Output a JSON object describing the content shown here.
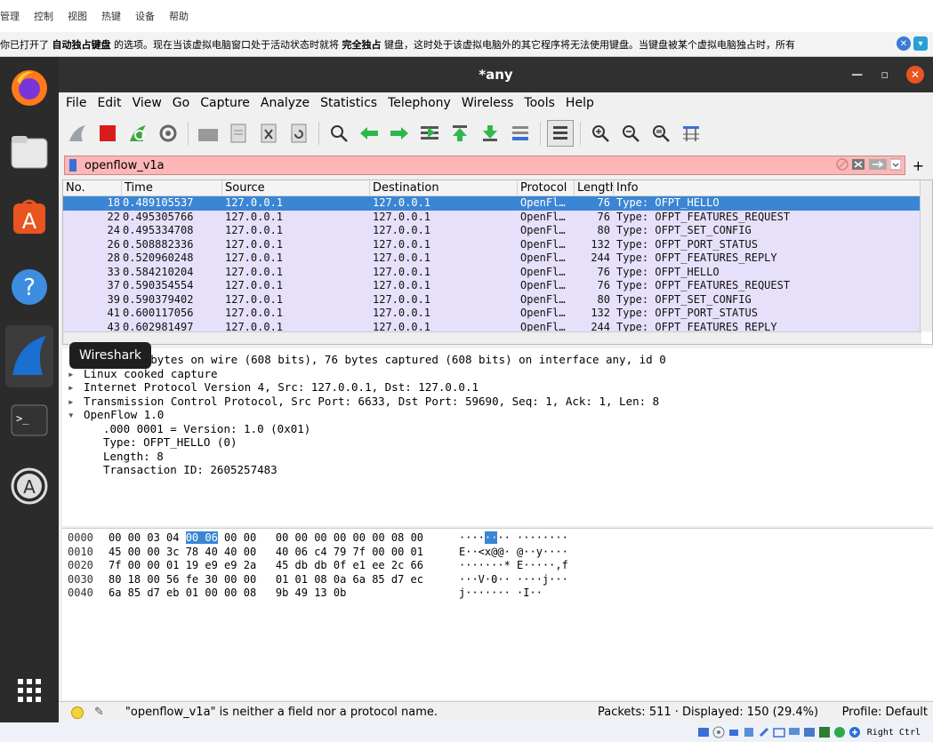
{
  "vm_menu": [
    "管理",
    "控制",
    "视图",
    "热键",
    "设备",
    "帮助"
  ],
  "banner": {
    "p1": "你已打开了",
    "b1": "自动独占键盘",
    "p2": "的选项。现在当该虚拟电脑窗口处于活动状态时就将",
    "b2": "完全独占",
    "p3": "键盘，这时处于该虚拟电脑外的其它程序将无法使用键盘。当键盘被某个虚拟电脑独占时，所有"
  },
  "window": {
    "title": "*any",
    "menu": [
      "File",
      "Edit",
      "View",
      "Go",
      "Capture",
      "Analyze",
      "Statistics",
      "Telephony",
      "Wireless",
      "Tools",
      "Help"
    ]
  },
  "dock_tooltip": "Wireshark",
  "filter": {
    "value": "openflow_v1a"
  },
  "packet_list": {
    "headers": [
      "No.",
      "Time",
      "Source",
      "Destination",
      "Protocol",
      "Length",
      "Info"
    ],
    "rows": [
      {
        "no": "18",
        "time": "0.489105537",
        "src": "127.0.0.1",
        "dst": "127.0.0.1",
        "proto": "OpenFl…",
        "len": "76",
        "info": "Type: OFPT_HELLO"
      },
      {
        "no": "22",
        "time": "0.495305766",
        "src": "127.0.0.1",
        "dst": "127.0.0.1",
        "proto": "OpenFl…",
        "len": "76",
        "info": "Type: OFPT_FEATURES_REQUEST"
      },
      {
        "no": "24",
        "time": "0.495334708",
        "src": "127.0.0.1",
        "dst": "127.0.0.1",
        "proto": "OpenFl…",
        "len": "80",
        "info": "Type: OFPT_SET_CONFIG"
      },
      {
        "no": "26",
        "time": "0.508882336",
        "src": "127.0.0.1",
        "dst": "127.0.0.1",
        "proto": "OpenFl…",
        "len": "132",
        "info": "Type: OFPT_PORT_STATUS"
      },
      {
        "no": "28",
        "time": "0.520960248",
        "src": "127.0.0.1",
        "dst": "127.0.0.1",
        "proto": "OpenFl…",
        "len": "244",
        "info": "Type: OFPT_FEATURES_REPLY"
      },
      {
        "no": "33",
        "time": "0.584210204",
        "src": "127.0.0.1",
        "dst": "127.0.0.1",
        "proto": "OpenFl…",
        "len": "76",
        "info": "Type: OFPT_HELLO"
      },
      {
        "no": "37",
        "time": "0.590354554",
        "src": "127.0.0.1",
        "dst": "127.0.0.1",
        "proto": "OpenFl…",
        "len": "76",
        "info": "Type: OFPT_FEATURES_REQUEST"
      },
      {
        "no": "39",
        "time": "0.590379402",
        "src": "127.0.0.1",
        "dst": "127.0.0.1",
        "proto": "OpenFl…",
        "len": "80",
        "info": "Type: OFPT_SET_CONFIG"
      },
      {
        "no": "41",
        "time": "0.600117056",
        "src": "127.0.0.1",
        "dst": "127.0.0.1",
        "proto": "OpenFl…",
        "len": "132",
        "info": "Type: OFPT_PORT_STATUS"
      },
      {
        "no": "43",
        "time": "0.602981497",
        "src": "127.0.0.1",
        "dst": "127.0.0.1",
        "proto": "OpenFl…",
        "len": "244",
        "info": "Type: OFPT_FEATURES_REPLY"
      }
    ]
  },
  "details": {
    "frame": "76 bytes on wire (608 bits), 76 bytes captured (608 bits) on interface any, id 0",
    "linux": "Linux cooked capture",
    "ip": "Internet Protocol Version 4, Src: 127.0.0.1, Dst: 127.0.0.1",
    "tcp": "Transmission Control Protocol, Src Port: 6633, Dst Port: 59690, Seq: 1, Ack: 1, Len: 8",
    "openflow": "OpenFlow 1.0",
    "version": ".000 0001 = Version: 1.0 (0x01)",
    "type": "Type: OFPT_HELLO (0)",
    "length": "Length: 8",
    "xid": "Transaction ID: 2605257483"
  },
  "bytes": [
    {
      "off": "0000",
      "hex_a": "00 00 03 04 ",
      "hex_hl": "00 06",
      "hex_b": " 00 00   00 00 00 00 00 00 08 00",
      "asc_a": "····",
      "asc_hl": "··",
      "asc_b": "·· ········"
    },
    {
      "off": "0010",
      "hex_a": "45 00 00 3c 78 40 40 00   40 06 c4 79 7f 00 00 01",
      "hex_hl": "",
      "hex_b": "",
      "asc_a": "E··<x@@· @··y····",
      "asc_hl": "",
      "asc_b": ""
    },
    {
      "off": "0020",
      "hex_a": "7f 00 00 01 19 e9 e9 2a   45 db db 0f e1 ee 2c 66",
      "hex_hl": "",
      "hex_b": "",
      "asc_a": "·······* E·····,f",
      "asc_hl": "",
      "asc_b": ""
    },
    {
      "off": "0030",
      "hex_a": "80 18 00 56 fe 30 00 00   01 01 08 0a 6a 85 d7 ec",
      "hex_hl": "",
      "hex_b": "",
      "asc_a": "···V·0·· ····j···",
      "asc_hl": "",
      "asc_b": ""
    },
    {
      "off": "0040",
      "hex_a": "6a 85 d7 eb 01 00 00 08   9b 49 13 0b",
      "hex_hl": "",
      "hex_b": "",
      "asc_a": "j······· ·I··",
      "asc_hl": "",
      "asc_b": ""
    }
  ],
  "status": {
    "message": "\"openflow_v1a\" is neither a field nor a protocol name.",
    "packets": "Packets: 511 · Displayed: 150 (29.4%)",
    "profile": "Profile: Default"
  },
  "host_tray_text": "Right Ctrl",
  "colors": {
    "accent": "#3b86d4",
    "filter_invalid": "#ffb6b6",
    "row_bg": "#e6e0fa",
    "close": "#e95420"
  }
}
